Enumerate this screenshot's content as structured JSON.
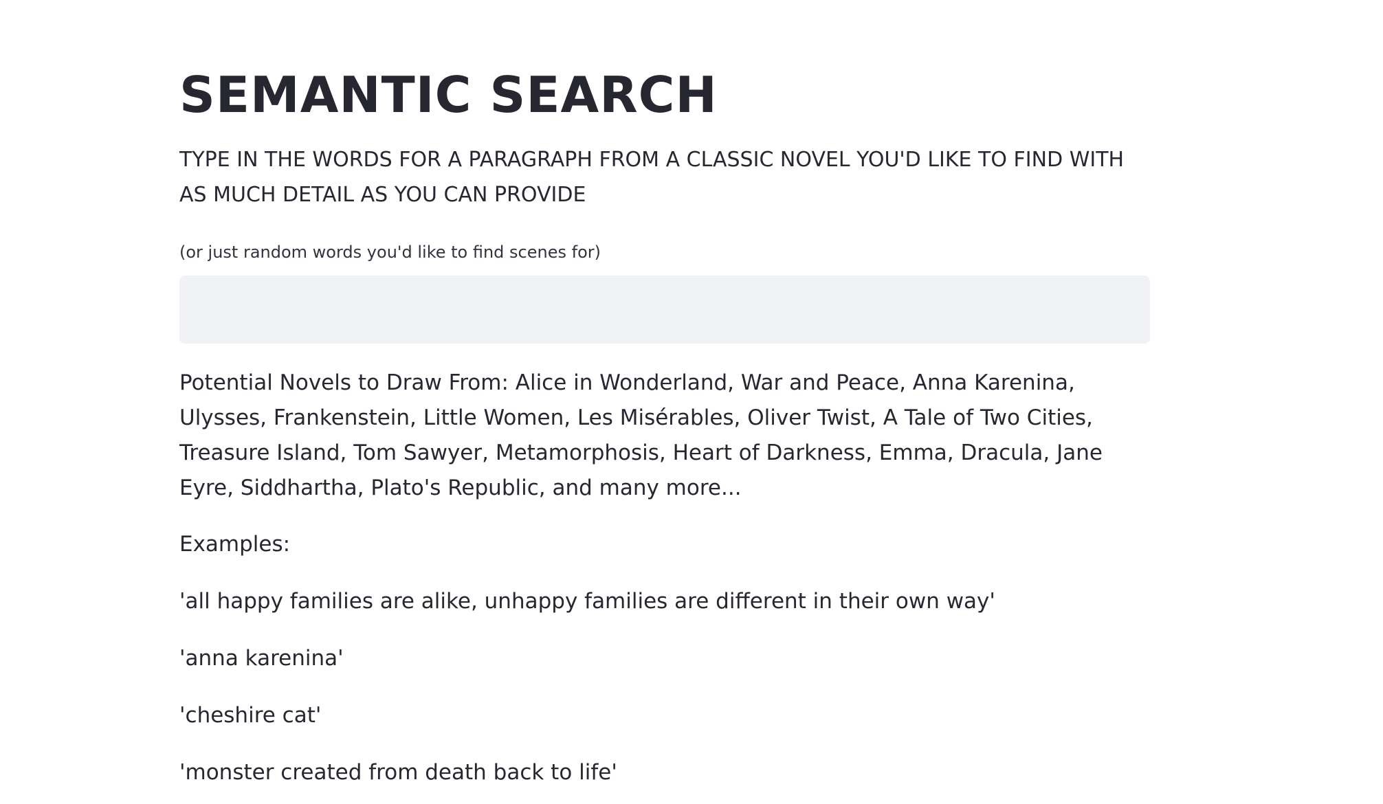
{
  "header": {
    "title": "SEMANTIC SEARCH",
    "subtitle": "TYPE IN THE WORDS FOR A PARAGRAPH FROM A CLASSIC NOVEL YOU'D LIKE TO FIND WITH AS MUCH DETAIL AS YOU CAN PROVIDE"
  },
  "search": {
    "label": "(or just random words you'd like to find scenes for)",
    "value": "",
    "placeholder": ""
  },
  "novels_text": "Potential Novels to Draw From: Alice in Wonderland, War and Peace, Anna Karenina, Ulysses, Frankenstein, Little Women, Les Misérables, Oliver Twist, A Tale of Two Cities, Treasure Island, Tom Sawyer, Metamorphosis, Heart of Darkness, Emma, Dracula, Jane Eyre, Siddhartha, Plato's Republic, and many more...",
  "examples": {
    "heading": "Examples:",
    "items": [
      "'all happy families are alike, unhappy families are different in their own way'",
      "'anna karenina'",
      "'cheshire cat'",
      "'monster created from death back to life'"
    ]
  }
}
